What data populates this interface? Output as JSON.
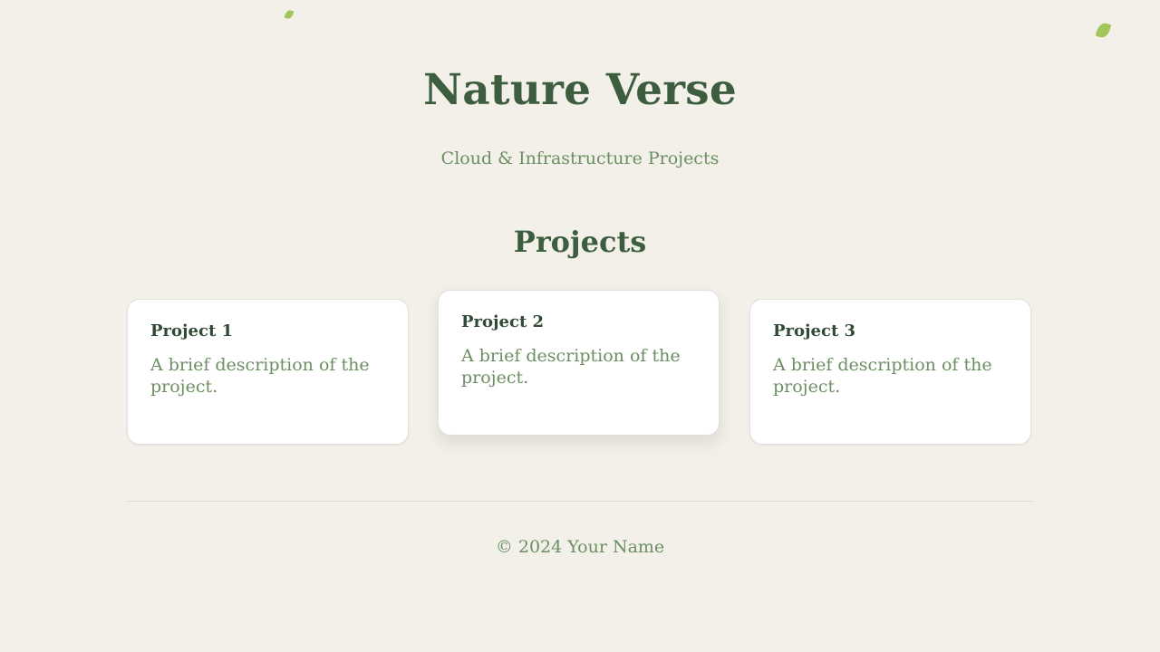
{
  "header": {
    "title": "Nature Verse",
    "subtitle": "Cloud & Infrastructure Projects"
  },
  "projects": {
    "heading": "Projects",
    "items": [
      {
        "title": "Project 1",
        "description": "A brief description of the project."
      },
      {
        "title": "Project 2",
        "description": "A brief description of the project."
      },
      {
        "title": "Project 3",
        "description": "A brief description of the project."
      }
    ]
  },
  "footer": {
    "text": "© 2024 Your Name"
  },
  "colors": {
    "background": "#f3f0e9",
    "heading": "#3c5e3f",
    "text": "#6b8f62",
    "card": "#ffffff",
    "leaf": "#a3c65a"
  },
  "icons": [
    "leaf-icon",
    "leaf-icon"
  ]
}
